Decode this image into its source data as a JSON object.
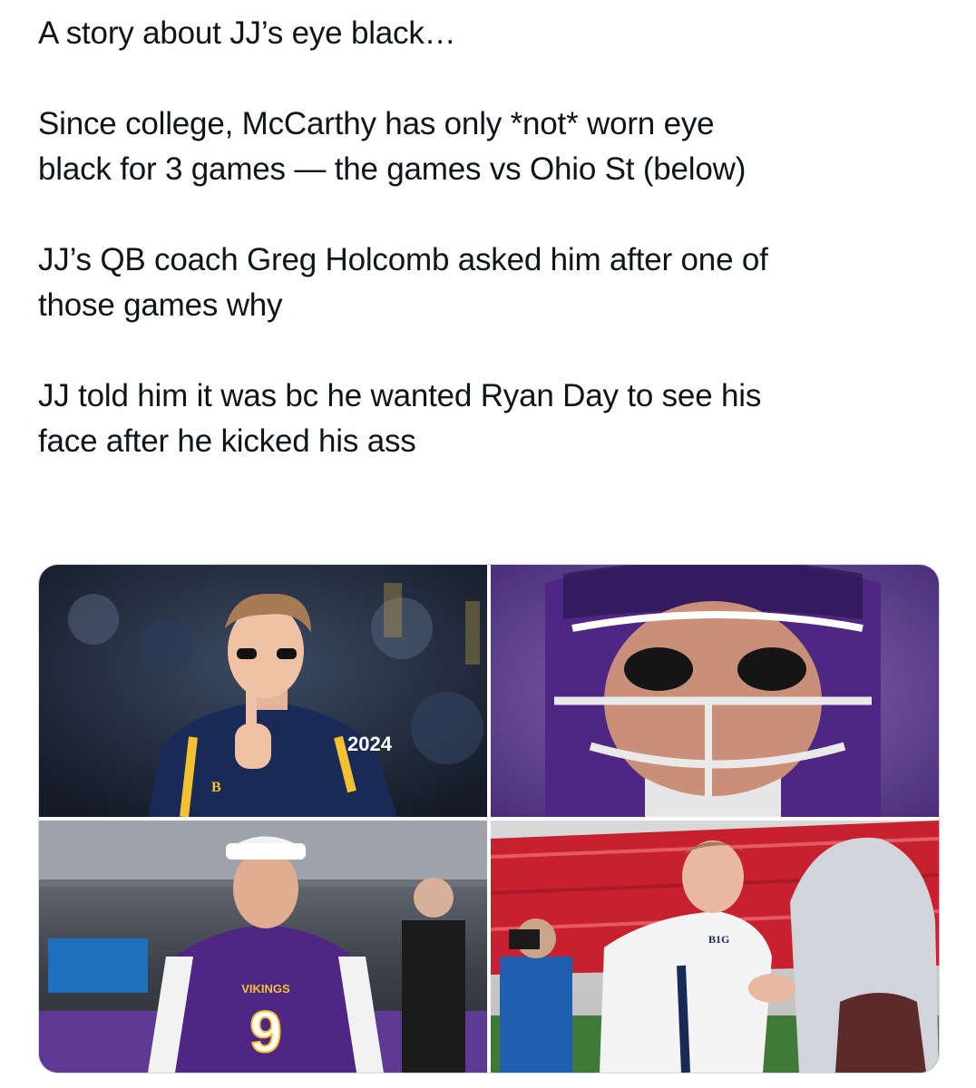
{
  "tweet": {
    "lines": {
      "p1_l1": "A story about JJ’s eye black…",
      "p2_l1": "Since college, McCarthy has only *not* worn eye",
      "p2_l2": "black for 3 games — the games vs Ohio St (below)",
      "p3_l1": "JJ’s QB coach Greg Holcomb asked him after one of",
      "p3_l2": "those games why",
      "p4_l1": "JJ told him it was bc he wanted Ryan Day to see his",
      "p4_l2": "face after he kicked his ass"
    }
  },
  "media": {
    "photos": [
      {
        "jersey_patch": "2024",
        "chest_logo": "B"
      },
      {},
      {
        "jersey_number": "9",
        "jersey_wordmark": "VIKINGS"
      },
      {
        "chest_logo": "B1G"
      }
    ]
  },
  "colors": {
    "text": "#0f1419",
    "border": "#cfd9de",
    "michigan_navy": "#1a2a57",
    "michigan_maize": "#f2c230",
    "vikings_purple": "#4f2683",
    "ohio_state_red": "#c8202f"
  }
}
